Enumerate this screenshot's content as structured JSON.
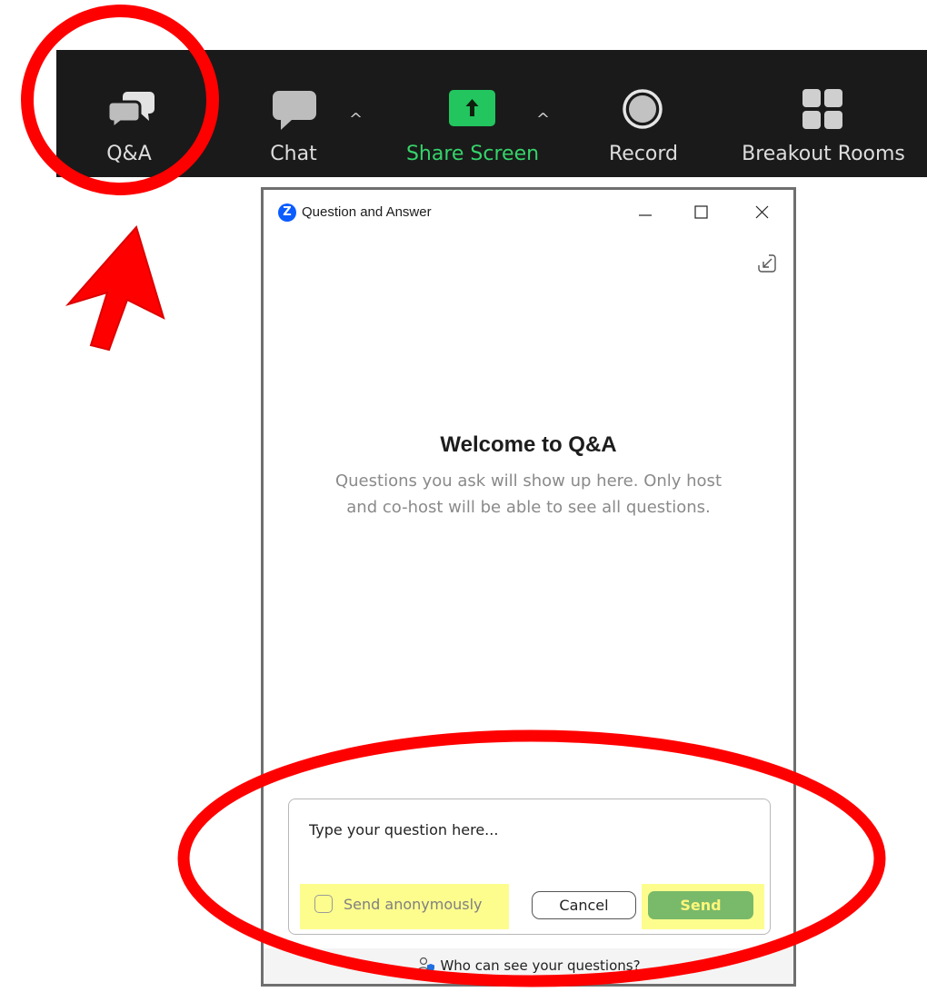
{
  "toolbar": {
    "items": [
      {
        "label": "Q&A",
        "icon": "qa-bubbles-icon"
      },
      {
        "label": "Chat",
        "icon": "chat-bubble-icon"
      },
      {
        "label": "Share Screen",
        "icon": "share-screen-arrow-icon"
      },
      {
        "label": "Record",
        "icon": "record-icon"
      },
      {
        "label": "Breakout Rooms",
        "icon": "breakout-rooms-icon"
      }
    ],
    "caret_glyph": "^"
  },
  "window": {
    "title": "Question and Answer",
    "logo_letter": "Z",
    "controls": [
      "minimize-icon",
      "maximize-icon",
      "close-icon"
    ]
  },
  "welcome": {
    "title": "Welcome to Q&A",
    "description": "Questions you ask will show up here. Only host and co-host will be able to see all questions."
  },
  "compose": {
    "placeholder": "Type your question here...",
    "anonymous_label": "Send anonymously",
    "anonymous_checked": false,
    "cancel_label": "Cancel",
    "send_label": "Send"
  },
  "footer": {
    "link_text": "Who can see your questions?"
  },
  "colors": {
    "toolbar_bg": "#1a1a1a",
    "share_green": "#22c55e",
    "annotation_red": "#ff0000",
    "highlight_yellow": "#fdfd8e",
    "send_green": "#79b96a",
    "zoom_blue": "#0b5cff"
  }
}
